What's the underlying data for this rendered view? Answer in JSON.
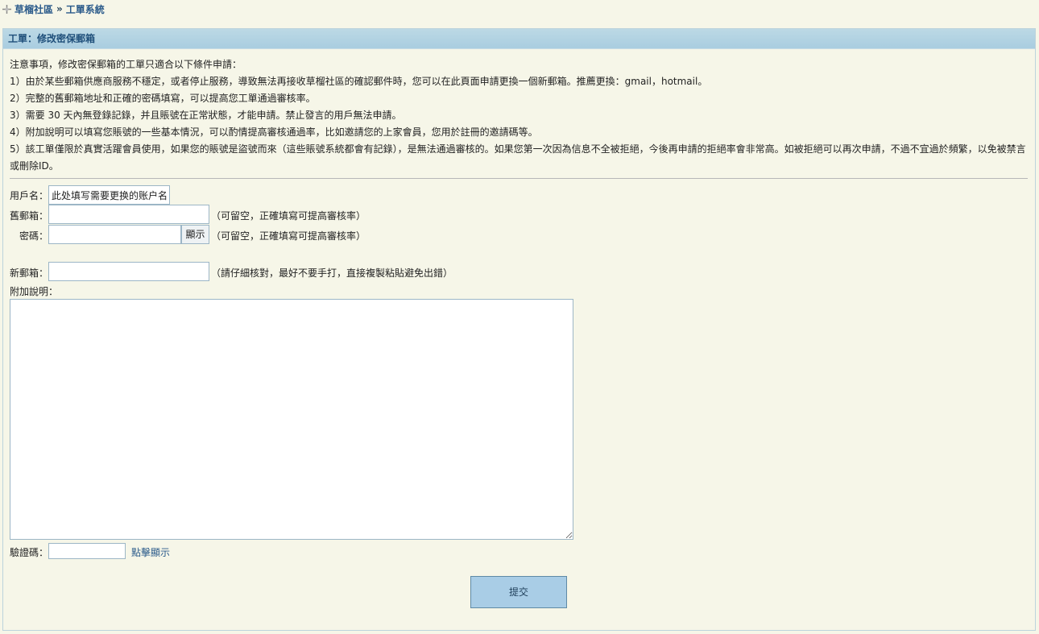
{
  "breadcrumb": {
    "home": "草榴社區",
    "separator": "»",
    "current": "工單系統"
  },
  "panel": {
    "title": "工單：修改密保郵箱"
  },
  "notes": [
    "注意事項，修改密保郵箱的工單只適合以下條件申請：",
    "1）由於某些郵箱供應商服務不穩定，或者停止服務，導致無法再接收草榴社區的確認郵件時，您可以在此頁面申請更換一個新郵箱。推薦更換：gmail，hotmail。",
    "2）完整的舊郵箱地址和正確的密碼填寫，可以提高您工單通過審核率。",
    "3）需要 30 天內無登錄記錄，并且賬號在正常狀態，才能申請。禁止發言的用戶無法申請。",
    "4）附加說明可以填寫您賬號的一些基本情況，可以酌情提高審核通過率，比如邀請您的上家會員，您用於註冊的邀請碼等。",
    "5）該工單僅限於真實活躍會員使用，如果您的賬號是盜號而來（這些賬號系統都會有記錄），是無法通過審核的。如果您第一次因為信息不全被拒絕，今後再申請的拒絕率會非常高。如被拒絕可以再次申請，不過不宜過於頻繁，以免被禁言或刪除ID。"
  ],
  "form": {
    "username_label": "用戶名：",
    "username_value": "此处填写需要更换的账户名",
    "old_email_label": "舊郵箱：",
    "old_email_hint": "（可留空，正確填寫可提高審核率）",
    "password_label": "密碼：",
    "show_button": "顯示",
    "password_hint": "（可留空，正確填寫可提高審核率）",
    "new_email_label": "新郵箱：",
    "new_email_hint": "（請仔細核對，最好不要手打，直接複製粘貼避免出錯）",
    "memo_label": "附加說明：",
    "captcha_label": "驗證碼：",
    "captcha_link": "點擊顯示",
    "submit_label": "提交"
  },
  "colors": {
    "header_bg": "#a9cde0",
    "accent_text": "#1f4f7a",
    "page_bg": "#f6f6e8"
  }
}
